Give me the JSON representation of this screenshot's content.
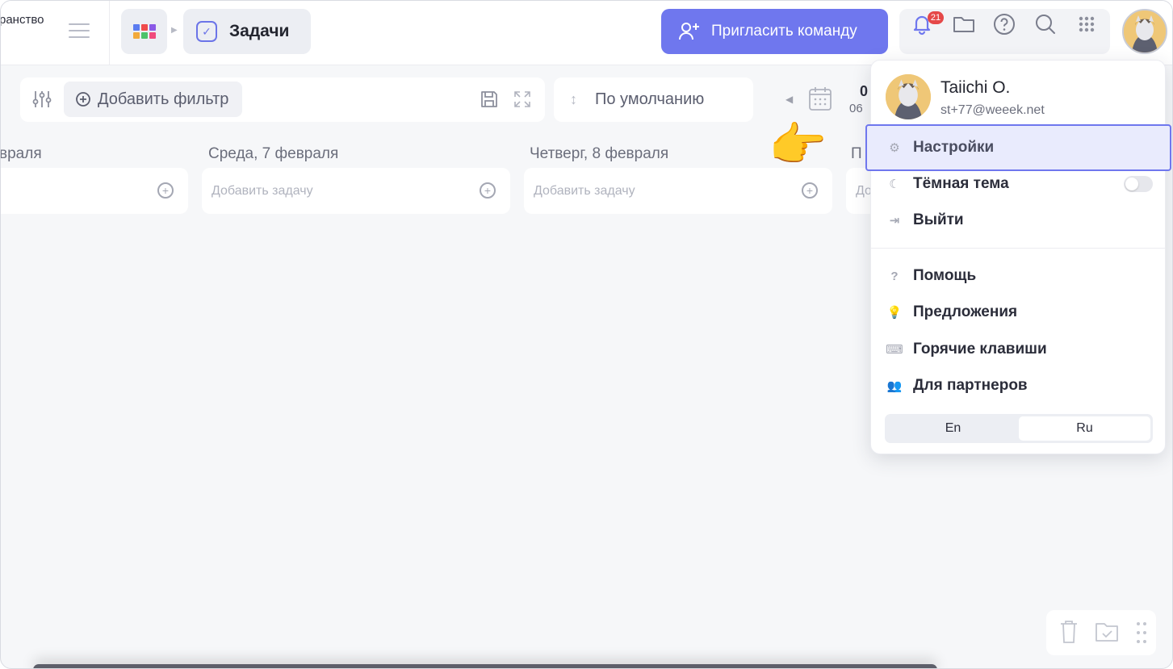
{
  "topbar": {
    "workspace_fragment": "ранство",
    "breadcrumb": {
      "current_label": "Задачи"
    },
    "invite_label": "Пригласить команду",
    "notifications_count": "21"
  },
  "toolbar": {
    "add_filter_label": "Добавить фильтр",
    "sort_label": "По умолчанию",
    "date_top": "0",
    "date_bottom": "06"
  },
  "days": [
    {
      "title": "враля",
      "placeholder": ""
    },
    {
      "title": "Среда, 7 февраля",
      "placeholder": "Добавить задачу"
    },
    {
      "title": "Четверг, 8 февраля",
      "placeholder": "Добавить задачу"
    },
    {
      "title": "П",
      "placeholder": "До"
    }
  ],
  "user_menu": {
    "name": "Taiichi O.",
    "email": "st+77@weeek.net",
    "items": [
      {
        "label": "Настройки",
        "icon": "gear-icon"
      },
      {
        "label": "Тёмная тема",
        "icon": "moon-icon"
      },
      {
        "label": "Выйти",
        "icon": "logout-icon"
      },
      {
        "label": "Помощь",
        "icon": "help-icon"
      },
      {
        "label": "Предложения",
        "icon": "lightbulb-icon"
      },
      {
        "label": "Горячие клавиши",
        "icon": "keyboard-icon"
      },
      {
        "label": "Для партнеров",
        "icon": "partners-icon"
      }
    ],
    "languages": [
      "En",
      "Ru"
    ],
    "selected_language": "Ru"
  },
  "colors": {
    "accent": "#6f77ee",
    "badge": "#e54848",
    "background": "#f6f7f9"
  }
}
